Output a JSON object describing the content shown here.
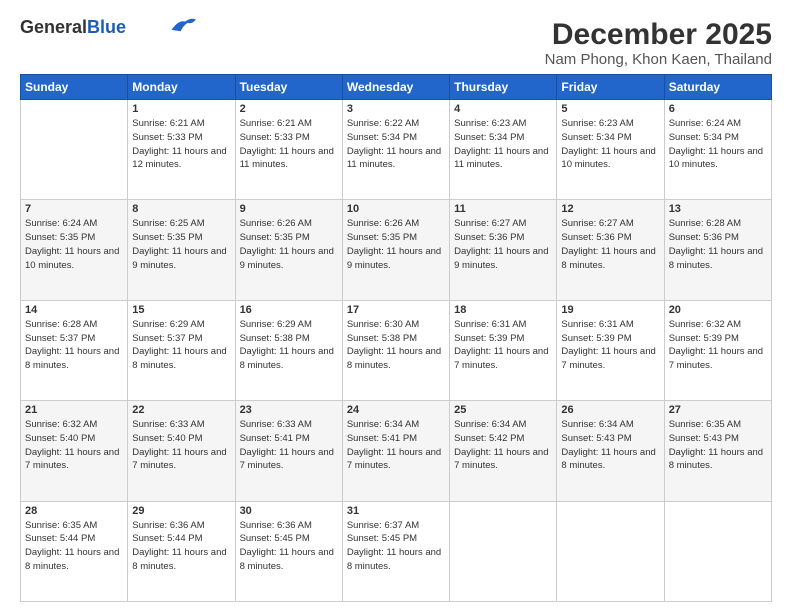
{
  "header": {
    "logo_general": "General",
    "logo_blue": "Blue",
    "title": "December 2025",
    "subtitle": "Nam Phong, Khon Kaen, Thailand"
  },
  "weekdays": [
    "Sunday",
    "Monday",
    "Tuesday",
    "Wednesday",
    "Thursday",
    "Friday",
    "Saturday"
  ],
  "weeks": [
    [
      {
        "day": "",
        "sunrise": "",
        "sunset": "",
        "daylight": ""
      },
      {
        "day": "1",
        "sunrise": "Sunrise: 6:21 AM",
        "sunset": "Sunset: 5:33 PM",
        "daylight": "Daylight: 11 hours and 12 minutes."
      },
      {
        "day": "2",
        "sunrise": "Sunrise: 6:21 AM",
        "sunset": "Sunset: 5:33 PM",
        "daylight": "Daylight: 11 hours and 11 minutes."
      },
      {
        "day": "3",
        "sunrise": "Sunrise: 6:22 AM",
        "sunset": "Sunset: 5:34 PM",
        "daylight": "Daylight: 11 hours and 11 minutes."
      },
      {
        "day": "4",
        "sunrise": "Sunrise: 6:23 AM",
        "sunset": "Sunset: 5:34 PM",
        "daylight": "Daylight: 11 hours and 11 minutes."
      },
      {
        "day": "5",
        "sunrise": "Sunrise: 6:23 AM",
        "sunset": "Sunset: 5:34 PM",
        "daylight": "Daylight: 11 hours and 10 minutes."
      },
      {
        "day": "6",
        "sunrise": "Sunrise: 6:24 AM",
        "sunset": "Sunset: 5:34 PM",
        "daylight": "Daylight: 11 hours and 10 minutes."
      }
    ],
    [
      {
        "day": "7",
        "sunrise": "Sunrise: 6:24 AM",
        "sunset": "Sunset: 5:35 PM",
        "daylight": "Daylight: 11 hours and 10 minutes."
      },
      {
        "day": "8",
        "sunrise": "Sunrise: 6:25 AM",
        "sunset": "Sunset: 5:35 PM",
        "daylight": "Daylight: 11 hours and 9 minutes."
      },
      {
        "day": "9",
        "sunrise": "Sunrise: 6:26 AM",
        "sunset": "Sunset: 5:35 PM",
        "daylight": "Daylight: 11 hours and 9 minutes."
      },
      {
        "day": "10",
        "sunrise": "Sunrise: 6:26 AM",
        "sunset": "Sunset: 5:35 PM",
        "daylight": "Daylight: 11 hours and 9 minutes."
      },
      {
        "day": "11",
        "sunrise": "Sunrise: 6:27 AM",
        "sunset": "Sunset: 5:36 PM",
        "daylight": "Daylight: 11 hours and 9 minutes."
      },
      {
        "day": "12",
        "sunrise": "Sunrise: 6:27 AM",
        "sunset": "Sunset: 5:36 PM",
        "daylight": "Daylight: 11 hours and 8 minutes."
      },
      {
        "day": "13",
        "sunrise": "Sunrise: 6:28 AM",
        "sunset": "Sunset: 5:36 PM",
        "daylight": "Daylight: 11 hours and 8 minutes."
      }
    ],
    [
      {
        "day": "14",
        "sunrise": "Sunrise: 6:28 AM",
        "sunset": "Sunset: 5:37 PM",
        "daylight": "Daylight: 11 hours and 8 minutes."
      },
      {
        "day": "15",
        "sunrise": "Sunrise: 6:29 AM",
        "sunset": "Sunset: 5:37 PM",
        "daylight": "Daylight: 11 hours and 8 minutes."
      },
      {
        "day": "16",
        "sunrise": "Sunrise: 6:29 AM",
        "sunset": "Sunset: 5:38 PM",
        "daylight": "Daylight: 11 hours and 8 minutes."
      },
      {
        "day": "17",
        "sunrise": "Sunrise: 6:30 AM",
        "sunset": "Sunset: 5:38 PM",
        "daylight": "Daylight: 11 hours and 8 minutes."
      },
      {
        "day": "18",
        "sunrise": "Sunrise: 6:31 AM",
        "sunset": "Sunset: 5:39 PM",
        "daylight": "Daylight: 11 hours and 7 minutes."
      },
      {
        "day": "19",
        "sunrise": "Sunrise: 6:31 AM",
        "sunset": "Sunset: 5:39 PM",
        "daylight": "Daylight: 11 hours and 7 minutes."
      },
      {
        "day": "20",
        "sunrise": "Sunrise: 6:32 AM",
        "sunset": "Sunset: 5:39 PM",
        "daylight": "Daylight: 11 hours and 7 minutes."
      }
    ],
    [
      {
        "day": "21",
        "sunrise": "Sunrise: 6:32 AM",
        "sunset": "Sunset: 5:40 PM",
        "daylight": "Daylight: 11 hours and 7 minutes."
      },
      {
        "day": "22",
        "sunrise": "Sunrise: 6:33 AM",
        "sunset": "Sunset: 5:40 PM",
        "daylight": "Daylight: 11 hours and 7 minutes."
      },
      {
        "day": "23",
        "sunrise": "Sunrise: 6:33 AM",
        "sunset": "Sunset: 5:41 PM",
        "daylight": "Daylight: 11 hours and 7 minutes."
      },
      {
        "day": "24",
        "sunrise": "Sunrise: 6:34 AM",
        "sunset": "Sunset: 5:41 PM",
        "daylight": "Daylight: 11 hours and 7 minutes."
      },
      {
        "day": "25",
        "sunrise": "Sunrise: 6:34 AM",
        "sunset": "Sunset: 5:42 PM",
        "daylight": "Daylight: 11 hours and 7 minutes."
      },
      {
        "day": "26",
        "sunrise": "Sunrise: 6:34 AM",
        "sunset": "Sunset: 5:43 PM",
        "daylight": "Daylight: 11 hours and 8 minutes."
      },
      {
        "day": "27",
        "sunrise": "Sunrise: 6:35 AM",
        "sunset": "Sunset: 5:43 PM",
        "daylight": "Daylight: 11 hours and 8 minutes."
      }
    ],
    [
      {
        "day": "28",
        "sunrise": "Sunrise: 6:35 AM",
        "sunset": "Sunset: 5:44 PM",
        "daylight": "Daylight: 11 hours and 8 minutes."
      },
      {
        "day": "29",
        "sunrise": "Sunrise: 6:36 AM",
        "sunset": "Sunset: 5:44 PM",
        "daylight": "Daylight: 11 hours and 8 minutes."
      },
      {
        "day": "30",
        "sunrise": "Sunrise: 6:36 AM",
        "sunset": "Sunset: 5:45 PM",
        "daylight": "Daylight: 11 hours and 8 minutes."
      },
      {
        "day": "31",
        "sunrise": "Sunrise: 6:37 AM",
        "sunset": "Sunset: 5:45 PM",
        "daylight": "Daylight: 11 hours and 8 minutes."
      },
      {
        "day": "",
        "sunrise": "",
        "sunset": "",
        "daylight": ""
      },
      {
        "day": "",
        "sunrise": "",
        "sunset": "",
        "daylight": ""
      },
      {
        "day": "",
        "sunrise": "",
        "sunset": "",
        "daylight": ""
      }
    ]
  ]
}
